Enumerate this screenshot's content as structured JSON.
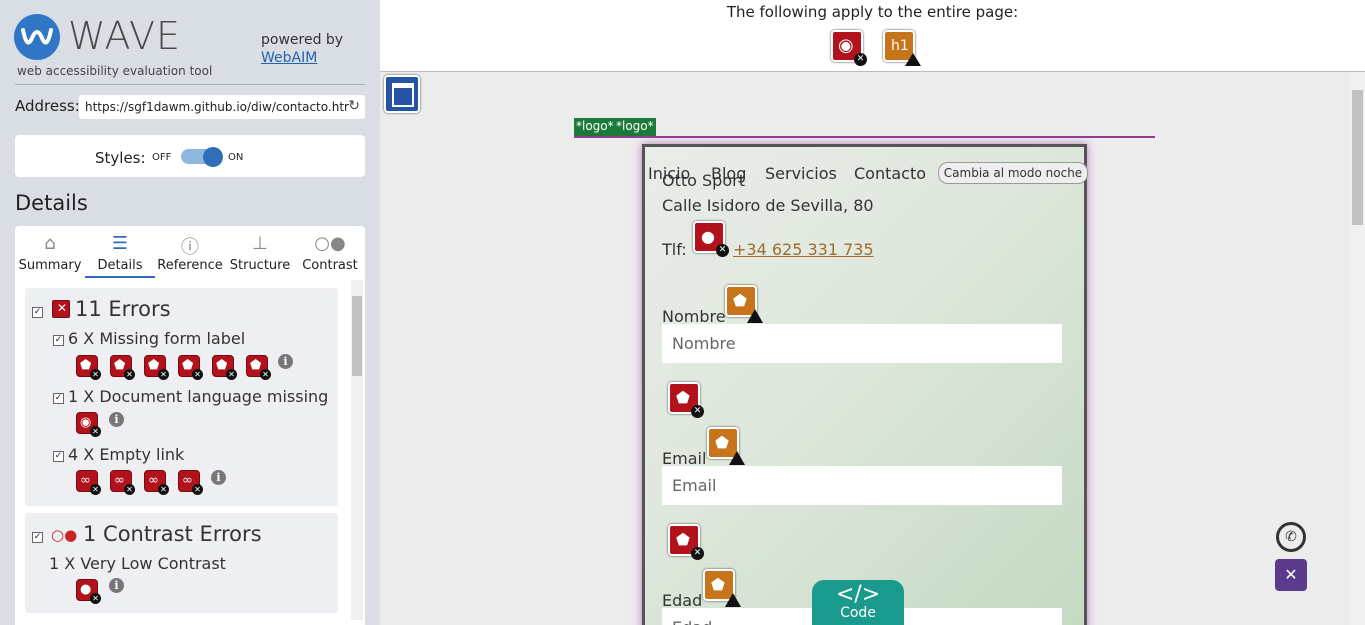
{
  "sidebar": {
    "title": "WAVE",
    "subtitle": "web accessibility evaluation tool",
    "powered_by": "powered by",
    "powered_link": "WebAIM",
    "address_label": "Address:",
    "address_value": "https://sgf1dawm.github.io/diw/contacto.htr",
    "styles_label": "Styles:",
    "styles_off": "OFF",
    "styles_on": "ON",
    "details_heading": "Details",
    "tabs": [
      {
        "label": "Summary",
        "icon": "home-icon"
      },
      {
        "label": "Details",
        "icon": "list-icon"
      },
      {
        "label": "Reference",
        "icon": "info-icon"
      },
      {
        "label": "Structure",
        "icon": "sitemap-icon"
      },
      {
        "label": "Contrast",
        "icon": "contrast-icon"
      }
    ],
    "errors": {
      "title": "11 Errors",
      "items": [
        {
          "label": "6 X Missing form label",
          "count": 6
        },
        {
          "label": "1 X Document language missing",
          "count": 1
        },
        {
          "label": "4 X Empty link",
          "count": 4
        }
      ]
    },
    "contrast": {
      "title": "1 Contrast Errors",
      "items": [
        {
          "label": "1 X Very Low Contrast",
          "count": 1
        }
      ]
    }
  },
  "main": {
    "page_notice": "The following apply to the entire page:",
    "logo_tags": [
      "*logo*",
      "*logo*"
    ],
    "nav": [
      "Inicio",
      "Blog",
      "Servicios",
      "Contacto"
    ],
    "night_mode_button": "Cambia al modo noche",
    "company_name": "Otto Sport",
    "address": "Calle Isidoro de Sevilla, 80",
    "phone_label": "Tlf:",
    "phone": "+34 625 331 735",
    "form": {
      "nombre_label": "Nombre",
      "nombre_placeholder": "Nombre",
      "email_label": "Email",
      "email_placeholder": "Email",
      "edad_label": "Edad",
      "edad_placeholder": "Edad"
    },
    "code_button": "Code",
    "code_symbol": "</>"
  },
  "colors": {
    "error": "#b2121c",
    "alert": "#c8741a",
    "accent": "#2f6fb8",
    "code_button": "#1a9a8c"
  }
}
